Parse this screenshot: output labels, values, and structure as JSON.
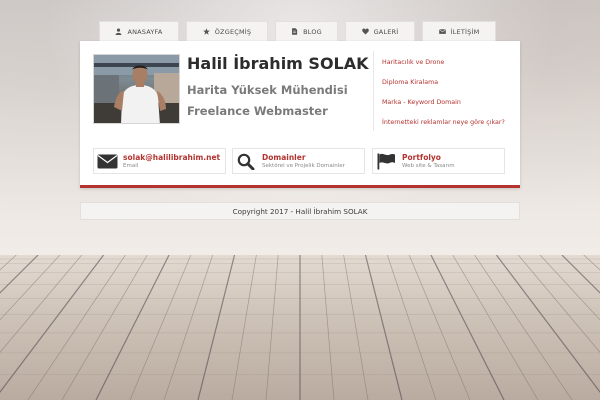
{
  "nav": {
    "tabs": [
      {
        "label": "ANASAYFA",
        "icon": "user-icon"
      },
      {
        "label": "ÖZGEÇMİŞ",
        "icon": "star-icon"
      },
      {
        "label": "BLOG",
        "icon": "document-icon"
      },
      {
        "label": "GALERİ",
        "icon": "heart-icon"
      },
      {
        "label": "İLETİŞİM",
        "icon": "envelope-icon"
      }
    ]
  },
  "profile": {
    "name": "Halil İbrahim SOLAK",
    "job_title": "Harita Yüksek Mühendisi",
    "role": "Freelance Webmaster"
  },
  "links": [
    "Haritacılık ve Drone",
    "Diploma Kiralama",
    "Marka - Keyword Domain",
    "İnternetteki reklamlar neye göre çıkar?"
  ],
  "contacts": {
    "email": {
      "title": "solak@halilibrahim.net",
      "subtitle": "Email",
      "icon": "envelope-icon"
    },
    "domains": {
      "title": "Domainler",
      "subtitle": "Sektörel ve Projelik Domainler",
      "icon": "search-icon"
    },
    "portfolio": {
      "title": "Portfolyo",
      "subtitle": "Web site & Tasarım",
      "icon": "flag-icon"
    }
  },
  "footer": {
    "copyright": "Copyright 2017 - Halil İbrahim SOLAK"
  },
  "colors": {
    "accent": "#b3332f",
    "text_dark": "#2c2c2c",
    "text_muted": "#7a7a7a"
  }
}
